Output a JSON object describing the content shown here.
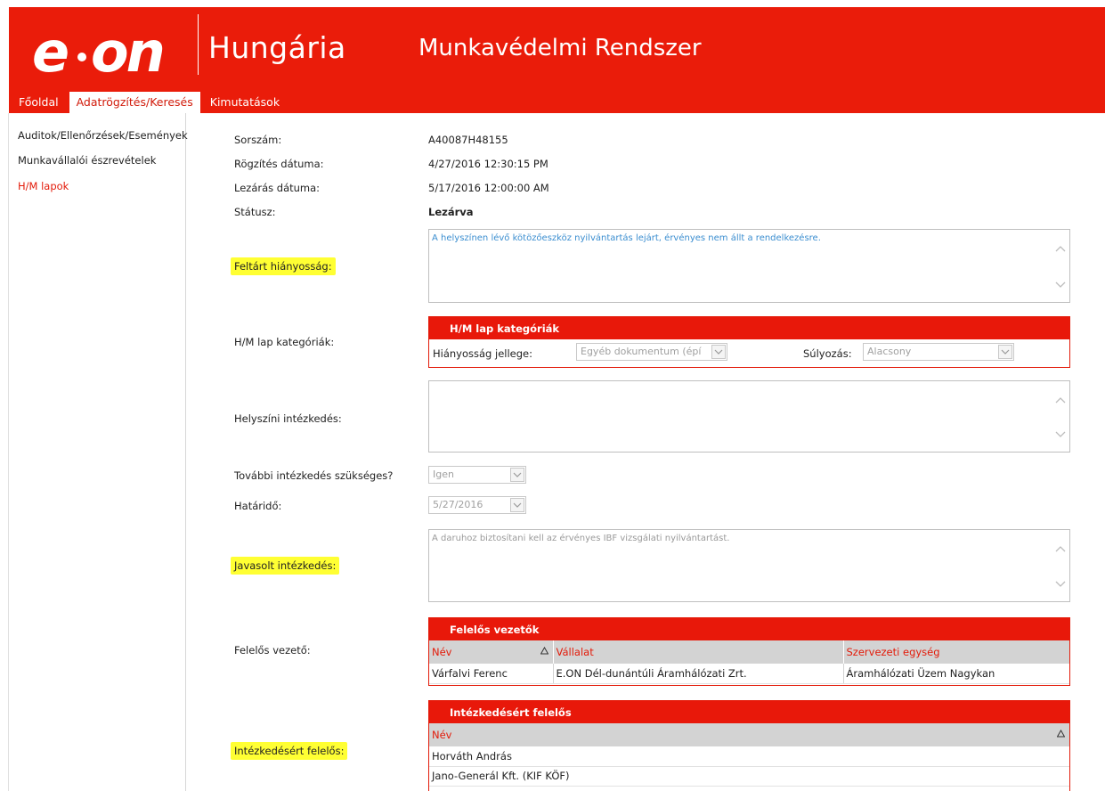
{
  "header": {
    "logo_text": "e·on",
    "subtitle": "Hungária",
    "app_title": "Munkavédelmi Rendszer"
  },
  "nav": {
    "tabs": [
      {
        "label": "Főoldal"
      },
      {
        "label": "Adatrögzítés/Keresés"
      },
      {
        "label": "Kimutatások"
      }
    ]
  },
  "sidebar": {
    "items": [
      {
        "label": "Auditok/Ellenőrzések/Események"
      },
      {
        "label": "Munkavállalói észrevételek"
      },
      {
        "label": "H/M lapok"
      }
    ]
  },
  "form": {
    "sorszam_label": "Sorszám:",
    "sorszam_value": "A40087H48155",
    "rogzites_label": "Rögzítés dátuma:",
    "rogzites_value": "4/27/2016 12:30:15 PM",
    "lezaras_label": "Lezárás dátuma:",
    "lezaras_value": "5/17/2016 12:00:00 AM",
    "statusz_label": "Státusz:",
    "statusz_value": "Lezárva",
    "feltart_label": "Feltárt hiányosság:",
    "feltart_text": "A helyszínen lévő kötözőeszköz nyilvántartás lejárt, érvényes nem állt a rendelkezésre.",
    "kategoriak_label": "H/M lap kategóriák:",
    "helyszini_label": "Helyszíni intézkedés:",
    "helyszini_text": "",
    "tovabbi_label": "További intézkedés szükséges?",
    "tovabbi_value": "Igen",
    "hatarido_label": "Határidő:",
    "hatarido_value": "5/27/2016",
    "javasolt_label": "Javasolt intézkedés:",
    "javasolt_text": "A daruhoz biztosítani kell az érvényes IBF vizsgálati nyilvántartást.",
    "felelos_label": "Felelős vezető:",
    "intezkedes_label": "Intézkedésért felelős:"
  },
  "kategoriak_panel": {
    "title": "H/M lap kategóriák",
    "jelleg_label": "Hiányosság jellege:",
    "jelleg_value": "Egyéb  dokumentum (épí",
    "sulyozas_label": "Súlyozás:",
    "sulyozas_value": "Alacsony"
  },
  "felelos_panel": {
    "title": "Felelős vezetők",
    "columns": [
      "Név",
      "Vállalat",
      "Szervezeti egység"
    ],
    "rows": [
      [
        "Várfalvi Ferenc",
        "E.ON Dél-dunántúli Áramhálózati Zrt.",
        "Áramhálózati Üzem Nagykan"
      ]
    ]
  },
  "intezkedes_panel": {
    "title": "Intézkedésért felelős",
    "columns": [
      "Név"
    ],
    "rows": [
      [
        "Horváth András"
      ],
      [
        "Jano-Generál Kft. (KIF KÖF)"
      ]
    ]
  },
  "colors": {
    "brand_red": "#ea1c0a",
    "highlight": "#ffff33",
    "link_blue": "#3b8ed0"
  }
}
